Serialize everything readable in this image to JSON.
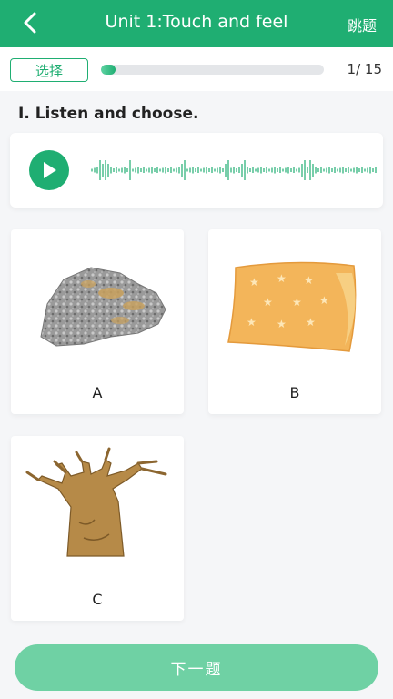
{
  "header": {
    "title": "Unit 1:Touch and feel",
    "skip_label": "跳题",
    "back_icon": "chevron-left-icon"
  },
  "progress": {
    "mode_label": "选择",
    "current": 1,
    "total": 15,
    "counter_text": "1/ 15",
    "fraction": 0.0667
  },
  "question": {
    "instruction": "I. Listen and choose.",
    "audio_icon": "play-icon"
  },
  "options": [
    {
      "label": "A",
      "image": "rock"
    },
    {
      "label": "B",
      "image": "pillow"
    },
    {
      "label": "C",
      "image": "tree"
    }
  ],
  "footer": {
    "next_label": "下一题"
  },
  "colors": {
    "brand": "#1fae72",
    "next_button": "#6fd1a4"
  }
}
